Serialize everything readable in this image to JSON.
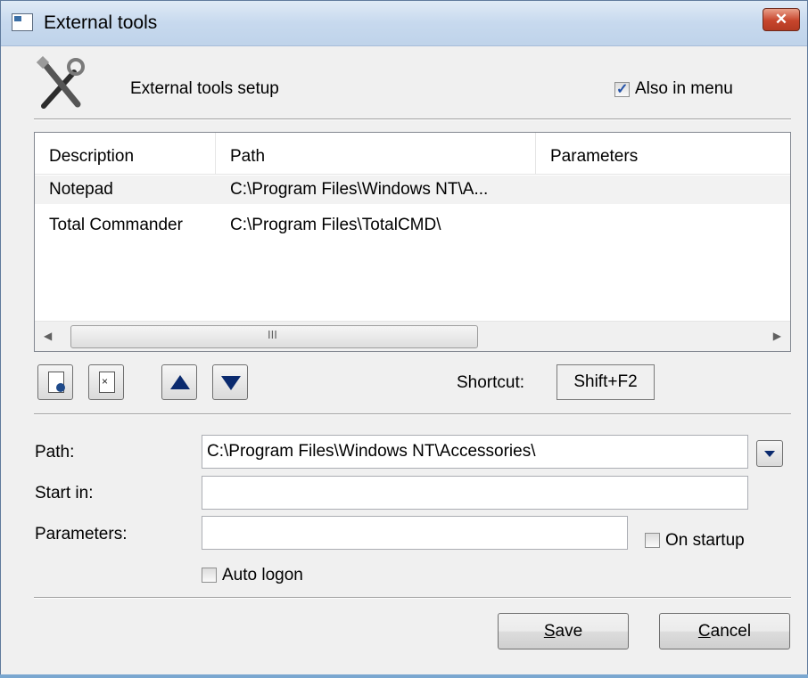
{
  "window": {
    "title": "External tools",
    "close_glyph": "✕"
  },
  "header": {
    "setup_label": "External tools setup",
    "also_in_menu_label": "Also in menu",
    "also_in_menu_checked": true,
    "icon": "tools-icon"
  },
  "list": {
    "columns": [
      "Description",
      "Path",
      "Parameters"
    ],
    "rows": [
      {
        "description": "Notepad",
        "path": "C:\\Program Files\\Windows NT\\A...",
        "parameters": "",
        "selected": true
      },
      {
        "description": "Total Commander",
        "path": "C:\\Program Files\\TotalCMD\\",
        "parameters": "",
        "selected": false
      }
    ],
    "scroll_left": "◀",
    "scroll_right": "▶",
    "scroll_grip": "III"
  },
  "toolbar": {
    "new_icon": "new-document-icon",
    "delete_icon": "delete-document-icon",
    "up_icon": "arrow-up-icon",
    "down_icon": "arrow-down-icon",
    "shortcut_label": "Shortcut:",
    "shortcut_value": "Shift+F2"
  },
  "form": {
    "path_label": "Path:",
    "path_value": "C:\\Program Files\\Windows NT\\Accessories\\",
    "start_in_label": "Start in:",
    "start_in_value": "",
    "parameters_label": "Parameters:",
    "parameters_value": "",
    "on_startup_label": "On startup",
    "on_startup_checked": false,
    "auto_logon_label": "Auto logon",
    "auto_logon_checked": false
  },
  "buttons": {
    "save_prefix": "S",
    "save_rest": "ave",
    "cancel_prefix": "C",
    "cancel_rest": "ancel"
  },
  "colors": {
    "title_gradient": "#c7d9ee",
    "close_red": "#c7452c",
    "arrow_navy": "#0a2a6e",
    "selected_row": "#f2f2f2"
  }
}
